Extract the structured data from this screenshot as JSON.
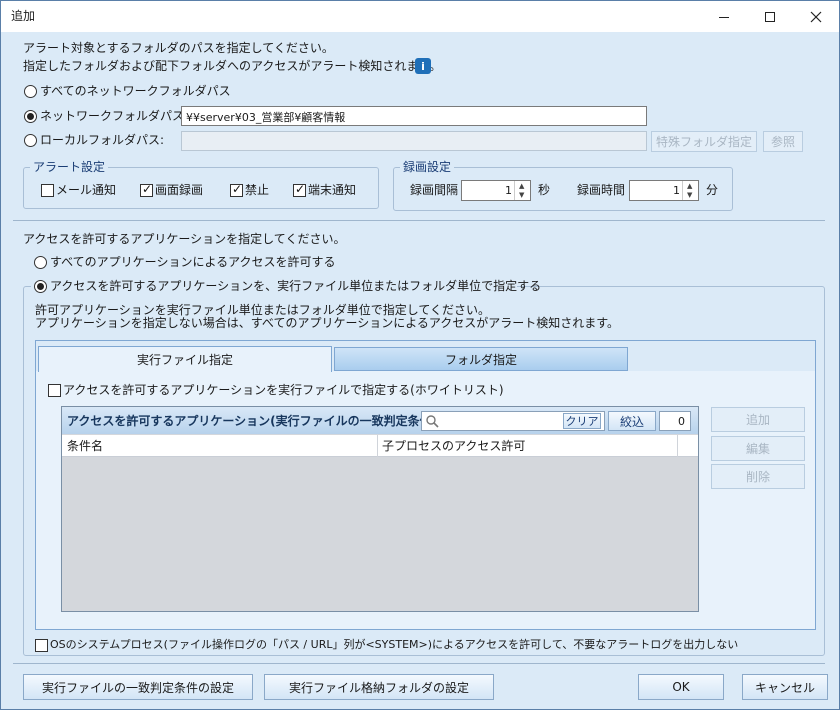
{
  "window": {
    "title": "追加"
  },
  "alert_path": {
    "description_line1": "アラート対象とするフォルダのパスを指定してください。",
    "description_line2": "指定したフォルダおよび配下フォルダへのアクセスがアラート検知されます。",
    "option_all_network": "すべてのネットワークフォルダパス",
    "option_network": "ネットワークフォルダパス:",
    "network_path_value": "¥¥server¥03_営業部¥顧客情報",
    "option_local": "ローカルフォルダパス:",
    "local_path_value": "",
    "special_folder_button": "特殊フォルダ指定",
    "browse_button": "参照",
    "selected_option": "network"
  },
  "alert_settings": {
    "legend": "アラート設定",
    "mail_label": "メール通知",
    "mail_checked": false,
    "screen_record_label": "画面録画",
    "screen_record_checked": true,
    "prohibit_label": "禁止",
    "prohibit_checked": true,
    "terminal_notify_label": "端末通知",
    "terminal_notify_checked": true
  },
  "record_settings": {
    "legend": "録画設定",
    "interval_label": "録画間隔",
    "interval_value": "1",
    "interval_unit": "秒",
    "duration_label": "録画時間",
    "duration_value": "1",
    "duration_unit": "分"
  },
  "app_access": {
    "description": "アクセスを許可するアプリケーションを指定してください。",
    "option_all_apps": "すべてのアプリケーションによるアクセスを許可する",
    "option_specify": "アクセスを許可するアプリケーションを、実行ファイル単位またはフォルダ単位で指定する",
    "selected_option": "specify",
    "specify_desc_line1": "許可アプリケーションを実行ファイル単位またはフォルダ単位で指定してください。",
    "specify_desc_line2": "アプリケーションを指定しない場合は、すべてのアプリケーションによるアクセスがアラート検知されます。"
  },
  "tabs": [
    {
      "label": "実行ファイル指定",
      "active": true
    },
    {
      "label": "フォルダ指定",
      "active": false
    }
  ],
  "whitelist": {
    "checkbox_label": "アクセスを許可するアプリケーションを実行ファイルで指定する(ホワイトリスト)",
    "checked": false,
    "grid_title": "アクセスを許可するアプリケーション(実行ファイルの一致判定条件)",
    "search_placeholder": "",
    "clear_button": "クリア",
    "filter_button": "絞込",
    "count": "0",
    "columns": [
      "条件名",
      "子プロセスのアクセス許可"
    ],
    "rows": [],
    "add_button": "追加",
    "edit_button": "編集",
    "delete_button": "削除"
  },
  "system_process": {
    "label": "OSのシステムプロセス(ファイル操作ログの「パス / URL」列が<SYSTEM>)によるアクセスを許可して、不要なアラートログを出力しない",
    "checked": false
  },
  "footer": {
    "match_condition_button": "実行ファイルの一致判定条件の設定",
    "exe_folder_button": "実行ファイル格納フォルダの設定",
    "ok_button": "OK",
    "cancel_button": "キャンセル"
  }
}
